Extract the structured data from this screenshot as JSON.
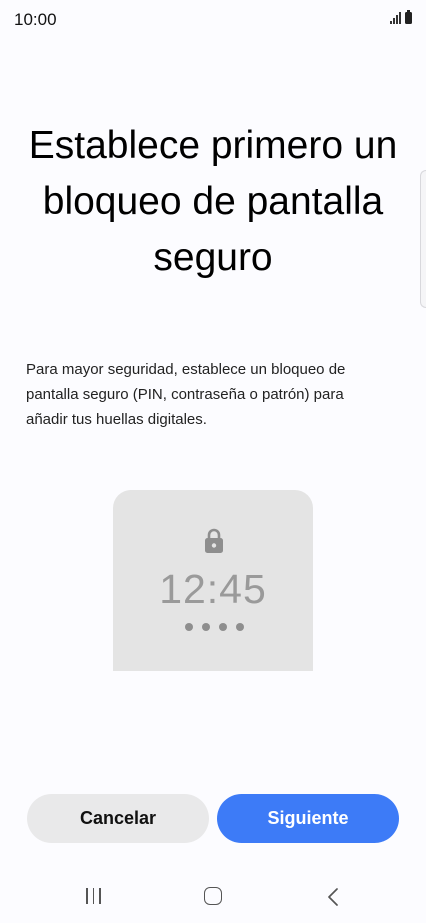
{
  "status_bar": {
    "time": "10:00"
  },
  "title": "Establece primero un bloqueo de pantalla seguro",
  "description": "Para mayor seguridad, establece un bloqueo de pantalla seguro (PIN, contraseña o patrón) para añadir tus huellas digitales.",
  "illustration": {
    "clock": "12:45",
    "icon": "lock-icon",
    "pin_dots": 4
  },
  "buttons": {
    "cancel_label": "Cancelar",
    "next_label": "Siguiente"
  },
  "colors": {
    "accent": "#3d7bf7",
    "secondary_button": "#e9e9ea",
    "background": "#fcfcff"
  },
  "nav_bar": {
    "icons": [
      "recents-icon",
      "home-icon",
      "back-icon"
    ]
  }
}
